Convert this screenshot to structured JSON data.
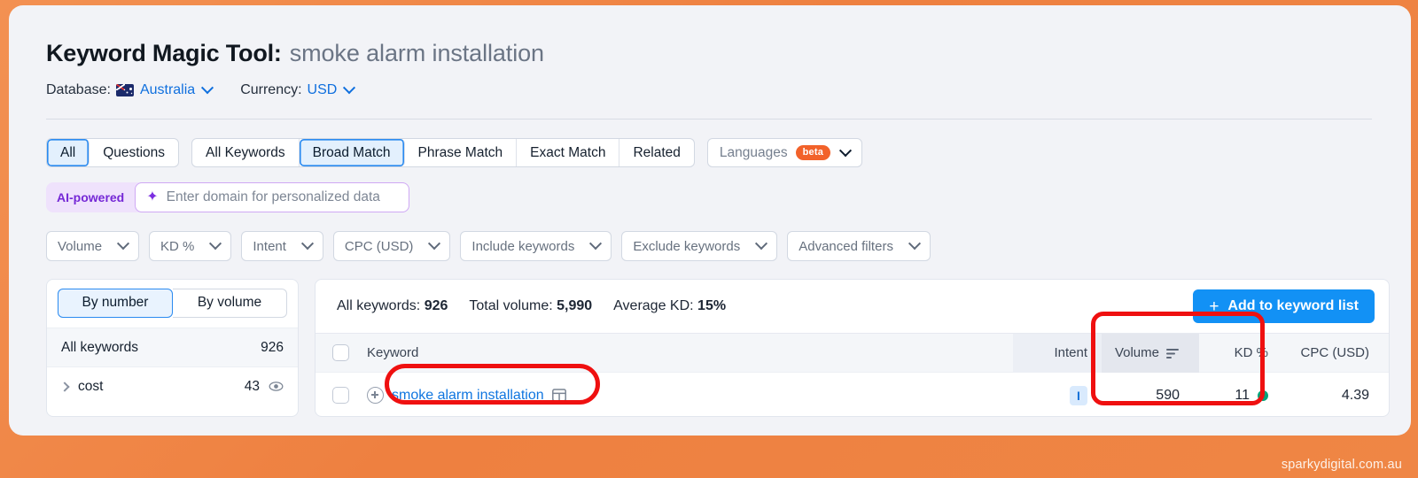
{
  "header": {
    "title_main": "Keyword Magic Tool:",
    "title_keyword": "smoke alarm installation",
    "database_label": "Database:",
    "database_value": "Australia",
    "currency_label": "Currency:",
    "currency_value": "USD"
  },
  "tabs": {
    "group_a": [
      {
        "label": "All",
        "active": true
      },
      {
        "label": "Questions",
        "active": false
      }
    ],
    "group_b": [
      {
        "label": "All Keywords",
        "active": false
      },
      {
        "label": "Broad Match",
        "active": true
      },
      {
        "label": "Phrase Match",
        "active": false
      },
      {
        "label": "Exact Match",
        "active": false
      },
      {
        "label": "Related",
        "active": false
      }
    ],
    "languages_label": "Languages",
    "languages_badge": "beta"
  },
  "ai_bar": {
    "badge": "AI-powered",
    "placeholder": "Enter domain for personalized data"
  },
  "filters": [
    {
      "label": "Volume"
    },
    {
      "label": "KD %"
    },
    {
      "label": "Intent"
    },
    {
      "label": "CPC (USD)"
    },
    {
      "label": "Include keywords"
    },
    {
      "label": "Exclude keywords"
    },
    {
      "label": "Advanced filters"
    }
  ],
  "sidebar": {
    "toggle": [
      {
        "label": "By number",
        "active": true
      },
      {
        "label": "By volume",
        "active": false
      }
    ],
    "rows": [
      {
        "label": "All keywords",
        "count": "926"
      },
      {
        "label": "cost",
        "count": "43"
      }
    ]
  },
  "table": {
    "stats": [
      {
        "label": "All keywords:",
        "value": "926"
      },
      {
        "label": "Total volume:",
        "value": "5,990"
      },
      {
        "label": "Average KD:",
        "value": "15%"
      }
    ],
    "add_button": "Add to keyword list",
    "columns": {
      "keyword": "Keyword",
      "intent": "Intent",
      "volume": "Volume",
      "kd": "KD %",
      "cpc": "CPC (USD)"
    },
    "rows": [
      {
        "keyword": "smoke alarm installation",
        "intent": "I",
        "volume": "590",
        "kd": "11",
        "cpc": "4.39"
      }
    ]
  },
  "watermark": "sparkydigital.com.au",
  "colors": {
    "accent_blue": "#1291f5",
    "link_blue": "#1076e0",
    "brand_orange": "#ee8040",
    "beta_orange": "#f2622a",
    "ai_purple": "#7528d6",
    "kd_green": "#00a37a",
    "annotation_red": "#ef1010"
  }
}
